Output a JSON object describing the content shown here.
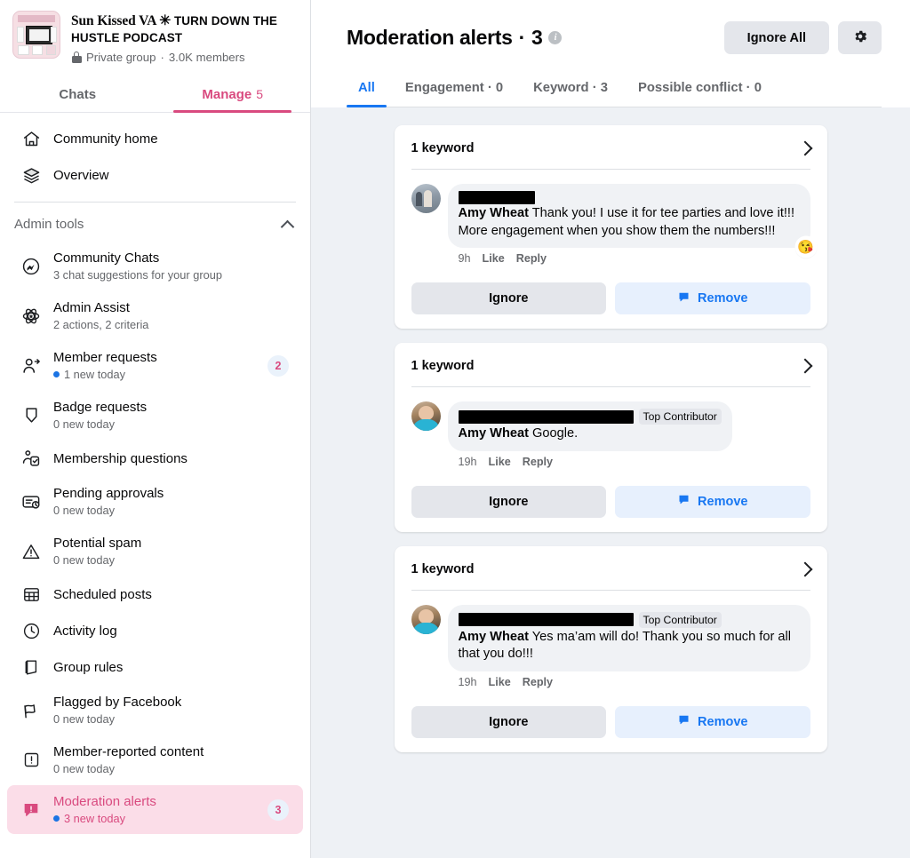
{
  "group": {
    "name_serif": "Sun Kissed VA",
    "name_star": "✳",
    "name_caps": "TURN DOWN THE HUSTLE PODCAST",
    "privacy": "Private group",
    "separator": "·",
    "members": "3.0K members",
    "thumb_icon": "group-cover-thumbnail"
  },
  "top_tabs": [
    {
      "label": "Chats",
      "count": "",
      "active": false
    },
    {
      "label": "Manage",
      "count": "5",
      "active": true
    }
  ],
  "sidebar": {
    "primary": [
      {
        "label": "Community home",
        "sub": "",
        "icon": "home-icon",
        "badge": "",
        "dot": false,
        "active": false
      },
      {
        "label": "Overview",
        "sub": "",
        "icon": "layers-icon",
        "badge": "",
        "dot": false,
        "active": false
      }
    ],
    "section_title": "Admin tools",
    "section_chevron": "chevron-up-icon",
    "items": [
      {
        "label": "Community Chats",
        "sub": "3 chat suggestions for your group",
        "icon": "messenger-icon",
        "badge": "",
        "dot": false,
        "active": false
      },
      {
        "label": "Admin Assist",
        "sub": "2 actions, 2 criteria",
        "icon": "admin-assist-icon",
        "badge": "",
        "dot": false,
        "active": false
      },
      {
        "label": "Member requests",
        "sub": "1 new today",
        "icon": "member-request-icon",
        "badge": "2",
        "dot": true,
        "active": false
      },
      {
        "label": "Badge requests",
        "sub": "0 new today",
        "icon": "badge-icon",
        "badge": "",
        "dot": false,
        "active": false
      },
      {
        "label": "Membership questions",
        "sub": "",
        "icon": "membership-questions-icon",
        "badge": "",
        "dot": false,
        "active": false
      },
      {
        "label": "Pending approvals",
        "sub": "0 new today",
        "icon": "pending-approvals-icon",
        "badge": "",
        "dot": false,
        "active": false
      },
      {
        "label": "Potential spam",
        "sub": "0 new today",
        "icon": "warning-triangle-icon",
        "badge": "",
        "dot": false,
        "active": false
      },
      {
        "label": "Scheduled posts",
        "sub": "",
        "icon": "calendar-grid-icon",
        "badge": "",
        "dot": false,
        "active": false
      },
      {
        "label": "Activity log",
        "sub": "",
        "icon": "clock-icon",
        "badge": "",
        "dot": false,
        "active": false
      },
      {
        "label": "Group rules",
        "sub": "",
        "icon": "book-icon",
        "badge": "",
        "dot": false,
        "active": false
      },
      {
        "label": "Flagged by Facebook",
        "sub": "0 new today",
        "icon": "flag-icon",
        "badge": "",
        "dot": false,
        "active": false
      },
      {
        "label": "Member-reported content",
        "sub": "0 new today",
        "icon": "exclamation-box-icon",
        "badge": "",
        "dot": false,
        "active": false
      },
      {
        "label": "Moderation alerts",
        "sub": "3 new today",
        "icon": "moderation-alert-icon",
        "badge": "3",
        "dot": true,
        "active": true
      }
    ]
  },
  "header": {
    "title": "Moderation alerts",
    "title_separator": "·",
    "title_count": "3",
    "info_icon": "info-icon",
    "ignore_all_label": "Ignore All",
    "settings_icon": "gear-icon"
  },
  "filter_tabs": [
    {
      "label": "All",
      "active": true
    },
    {
      "label": "Engagement · 0",
      "active": false
    },
    {
      "label": "Keyword · 3",
      "active": false
    },
    {
      "label": "Possible conflict · 0",
      "active": false
    }
  ],
  "alerts": [
    {
      "keyword_label": "1 keyword",
      "expand_icon": "chevron-right-icon",
      "avatar": "family-photo-avatar",
      "avatar_style": "av-family",
      "redact_width": "r1",
      "top_contributor": "",
      "mention": "Amy Wheat",
      "text": "Thank you! I use it for tee parties and love it!!! More engagement when you show them the numbers!!!",
      "time": "9h",
      "like_label": "Like",
      "reply_label": "Reply",
      "reaction": "😘",
      "ignore_label": "Ignore",
      "remove_label": "Remove",
      "remove_icon": "comment-icon"
    },
    {
      "keyword_label": "1 keyword",
      "expand_icon": "chevron-right-icon",
      "avatar": "woman-photo-avatar",
      "avatar_style": "av-woman",
      "redact_width": "r2",
      "top_contributor": "Top Contributor",
      "mention": "Amy Wheat",
      "text": "Google.",
      "time": "19h",
      "like_label": "Like",
      "reply_label": "Reply",
      "reaction": "",
      "ignore_label": "Ignore",
      "remove_label": "Remove",
      "remove_icon": "comment-icon"
    },
    {
      "keyword_label": "1 keyword",
      "expand_icon": "chevron-right-icon",
      "avatar": "woman-photo-avatar",
      "avatar_style": "av-woman",
      "redact_width": "r2",
      "top_contributor": "Top Contributor",
      "mention": "Amy Wheat",
      "text": "Yes ma’am will do! Thank you so much for all that you do!!!",
      "time": "19h",
      "like_label": "Like",
      "reply_label": "Reply",
      "reaction": "",
      "ignore_label": "Ignore",
      "remove_label": "Remove",
      "remove_icon": "comment-icon"
    }
  ],
  "colors": {
    "brand_pink": "#d94a7f",
    "facebook_blue": "#1877f2",
    "active_nav_bg": "#fbdde8",
    "body_bg": "#eef1f5"
  }
}
